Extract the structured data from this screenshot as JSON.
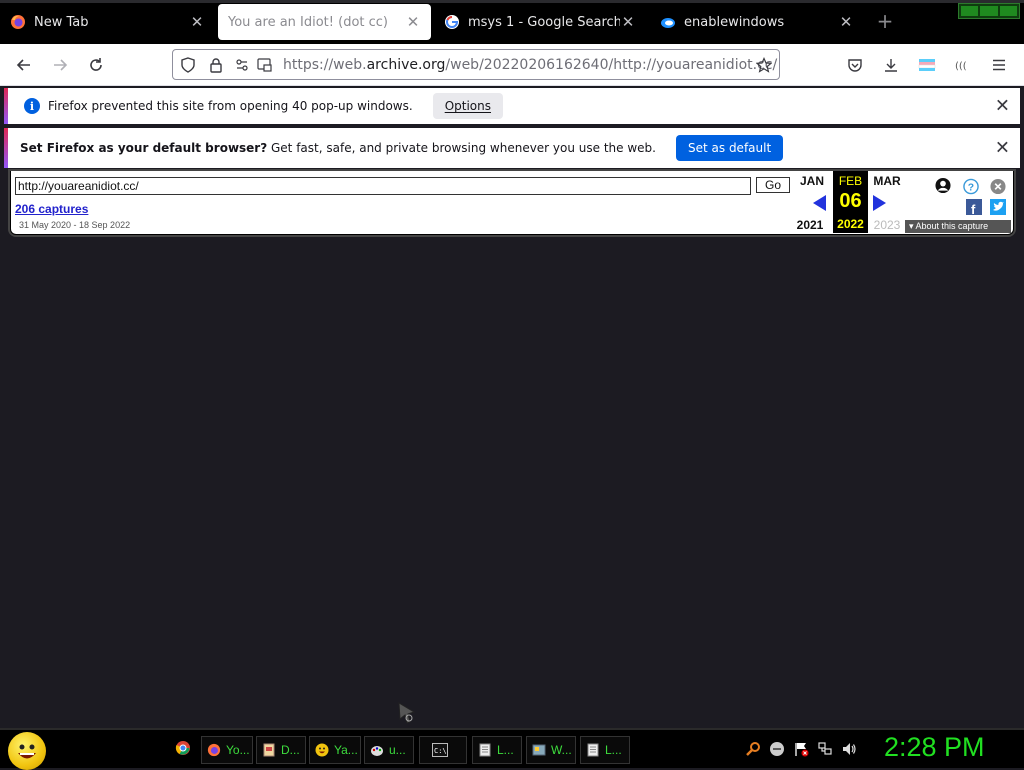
{
  "tabs": [
    {
      "title": "New Tab",
      "favicon": "firefox-icon",
      "active": false
    },
    {
      "title": "You are an Idiot! (dot cc)",
      "favicon": "none",
      "active": true
    },
    {
      "title": "msys 1 - Google Search",
      "favicon": "google-icon",
      "active": false
    },
    {
      "title": "enablewindows",
      "favicon": "edge-icon",
      "active": false
    }
  ],
  "toolbar": {
    "url_prefix": "https://web.",
    "url_domain": "archive.org",
    "url_rest": "/web/20220206162640/http://youareanidiot.cc/"
  },
  "notifications": {
    "popup_message": "Firefox prevented this site from opening 40 pop-up windows.",
    "popup_options_label": "Options",
    "default_bold": "Set Firefox as your default browser?",
    "default_text": " Get fast, safe, and private browsing whenever you use the web.",
    "default_button_label": "Set as default"
  },
  "wayback": {
    "url_value": "http://youareanidiot.cc/",
    "go_label": "Go",
    "captures": "206 captures",
    "range": "31 May 2020 - 18 Sep 2022",
    "prev_month": "JAN",
    "cur_month": "FEB",
    "next_month": "MAR",
    "cur_day": "06",
    "prev_year": "2021",
    "cur_year": "2022",
    "next_year": "2023",
    "about": "About this capture"
  },
  "taskbar": {
    "items": [
      {
        "label": "Yo...",
        "icon": "firefox-icon"
      },
      {
        "label": "D...",
        "icon": "document-icon"
      },
      {
        "label": "Ya...",
        "icon": "smiley-icon"
      },
      {
        "label": "u...",
        "icon": "paint-icon"
      },
      {
        "label": "",
        "icon": "terminal-icon"
      },
      {
        "label": "L...",
        "icon": "notepad-icon"
      },
      {
        "label": "W...",
        "icon": "app-icon"
      },
      {
        "label": "L...",
        "icon": "notepad-icon"
      }
    ],
    "clock": "2:28 PM"
  },
  "colors": {
    "accent_blue": "#0061e0",
    "wayback_yellow": "#ffff00",
    "clock_green": "#21e021",
    "taskbar_text_green": "#3ddc3d"
  }
}
